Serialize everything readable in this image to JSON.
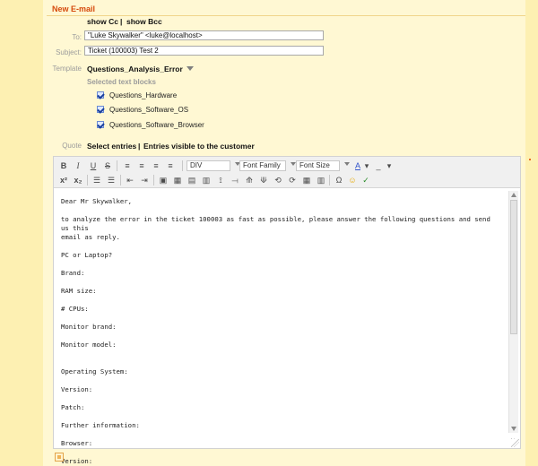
{
  "header": {
    "title": "New E-mail"
  },
  "links": {
    "show_cc": "show Cc",
    "separator": "|",
    "show_bcc": "show Bcc"
  },
  "form": {
    "to": {
      "label": "To:",
      "value": "\"Luke Skywalker\" <luke@localhost>"
    },
    "subject": {
      "label": "Subject:",
      "value": "Ticket (100003) Test 2"
    },
    "template": {
      "label": "Template",
      "value": "Questions_Analysis_Error"
    },
    "selected_text_blocks": "Selected text blocks",
    "text_blocks": [
      {
        "label": "Questions_Hardware"
      },
      {
        "label": "Questions_Software_OS"
      },
      {
        "label": "Questions_Software_Browser"
      }
    ],
    "quote": {
      "label": "Quote",
      "select_entries": "Select entries",
      "separator": "|",
      "entries_visible": "Entries visible to the customer"
    }
  },
  "toolbar": {
    "block_format": "DIV",
    "font_family": "Font Family",
    "font_size": "Font Size"
  },
  "editor": {
    "lines": [
      "Dear Mr Skywalker,",
      "",
      "to analyze the error in the ticket 100003 as fast as possible, please answer the following questions and send us this",
      "email as reply.",
      "",
      "PC or Laptop?",
      "",
      "Brand:",
      "",
      "RAM size:",
      "",
      "# CPUs:",
      "",
      "Monitor brand:",
      "",
      "Monitor model:",
      "",
      "",
      "Operating System:",
      "",
      "Version:",
      "",
      "Patch:",
      "",
      "Further information:",
      "",
      "Browser:",
      "",
      "Version:"
    ]
  },
  "colors": {
    "accent": "#d64a0c",
    "panel": "#fff8d3",
    "border": "#a9a9a9"
  }
}
